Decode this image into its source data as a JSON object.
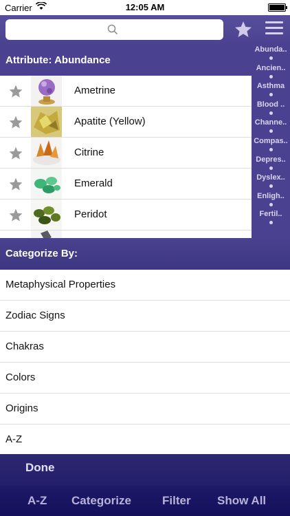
{
  "status_bar": {
    "carrier": "Carrier",
    "time": "12:05 AM"
  },
  "search": {
    "placeholder": ""
  },
  "attribute_header": "Attribute: Abundance",
  "index_items": [
    "Abunda..",
    "Ancien..",
    "Asthma",
    "Blood ..",
    "Channe..",
    "Compas..",
    "Depres..",
    "Dyslex..",
    "Enligh..",
    "Fertil.."
  ],
  "stones": [
    {
      "name": "Ametrine",
      "image": "amethyst-sphere-thumbnail"
    },
    {
      "name": "Apatite (Yellow)",
      "image": "yellow-apatite-thumbnail"
    },
    {
      "name": "Citrine",
      "image": "citrine-cluster-thumbnail"
    },
    {
      "name": "Emerald",
      "image": "emerald-stones-thumbnail"
    },
    {
      "name": "Peridot",
      "image": "peridot-stones-thumbnail"
    },
    {
      "name": "",
      "image": "partial-stone-thumbnail"
    }
  ],
  "categorize": {
    "header": "Categorize By:",
    "items": [
      "Metaphysical Properties",
      "Zodiac Signs",
      "Chakras",
      "Colors",
      "Origins",
      "A-Z"
    ]
  },
  "bottom": {
    "done_label": "Done",
    "tabs": [
      "A-Z",
      "Categorize",
      "Filter",
      "Show All"
    ]
  },
  "colors": {
    "accent": "#4a4290",
    "dark": "#1a1560",
    "star_grey": "#9a9a9a",
    "index_text": "#d8d5f0"
  }
}
